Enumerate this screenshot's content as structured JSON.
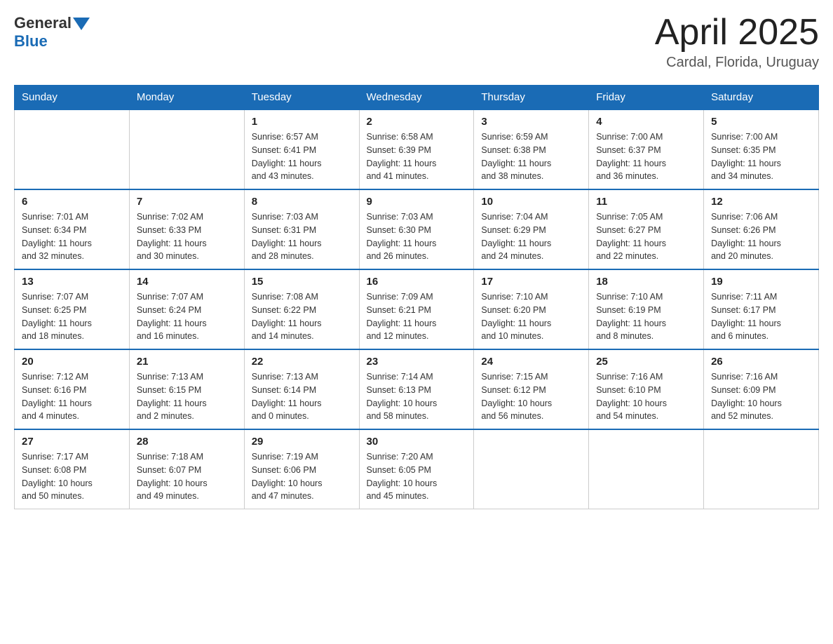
{
  "logo": {
    "text_general": "General",
    "text_blue": "Blue"
  },
  "title": "April 2025",
  "location": "Cardal, Florida, Uruguay",
  "days_of_week": [
    "Sunday",
    "Monday",
    "Tuesday",
    "Wednesday",
    "Thursday",
    "Friday",
    "Saturday"
  ],
  "weeks": [
    [
      {
        "day": "",
        "info": ""
      },
      {
        "day": "",
        "info": ""
      },
      {
        "day": "1",
        "info": "Sunrise: 6:57 AM\nSunset: 6:41 PM\nDaylight: 11 hours\nand 43 minutes."
      },
      {
        "day": "2",
        "info": "Sunrise: 6:58 AM\nSunset: 6:39 PM\nDaylight: 11 hours\nand 41 minutes."
      },
      {
        "day": "3",
        "info": "Sunrise: 6:59 AM\nSunset: 6:38 PM\nDaylight: 11 hours\nand 38 minutes."
      },
      {
        "day": "4",
        "info": "Sunrise: 7:00 AM\nSunset: 6:37 PM\nDaylight: 11 hours\nand 36 minutes."
      },
      {
        "day": "5",
        "info": "Sunrise: 7:00 AM\nSunset: 6:35 PM\nDaylight: 11 hours\nand 34 minutes."
      }
    ],
    [
      {
        "day": "6",
        "info": "Sunrise: 7:01 AM\nSunset: 6:34 PM\nDaylight: 11 hours\nand 32 minutes."
      },
      {
        "day": "7",
        "info": "Sunrise: 7:02 AM\nSunset: 6:33 PM\nDaylight: 11 hours\nand 30 minutes."
      },
      {
        "day": "8",
        "info": "Sunrise: 7:03 AM\nSunset: 6:31 PM\nDaylight: 11 hours\nand 28 minutes."
      },
      {
        "day": "9",
        "info": "Sunrise: 7:03 AM\nSunset: 6:30 PM\nDaylight: 11 hours\nand 26 minutes."
      },
      {
        "day": "10",
        "info": "Sunrise: 7:04 AM\nSunset: 6:29 PM\nDaylight: 11 hours\nand 24 minutes."
      },
      {
        "day": "11",
        "info": "Sunrise: 7:05 AM\nSunset: 6:27 PM\nDaylight: 11 hours\nand 22 minutes."
      },
      {
        "day": "12",
        "info": "Sunrise: 7:06 AM\nSunset: 6:26 PM\nDaylight: 11 hours\nand 20 minutes."
      }
    ],
    [
      {
        "day": "13",
        "info": "Sunrise: 7:07 AM\nSunset: 6:25 PM\nDaylight: 11 hours\nand 18 minutes."
      },
      {
        "day": "14",
        "info": "Sunrise: 7:07 AM\nSunset: 6:24 PM\nDaylight: 11 hours\nand 16 minutes."
      },
      {
        "day": "15",
        "info": "Sunrise: 7:08 AM\nSunset: 6:22 PM\nDaylight: 11 hours\nand 14 minutes."
      },
      {
        "day": "16",
        "info": "Sunrise: 7:09 AM\nSunset: 6:21 PM\nDaylight: 11 hours\nand 12 minutes."
      },
      {
        "day": "17",
        "info": "Sunrise: 7:10 AM\nSunset: 6:20 PM\nDaylight: 11 hours\nand 10 minutes."
      },
      {
        "day": "18",
        "info": "Sunrise: 7:10 AM\nSunset: 6:19 PM\nDaylight: 11 hours\nand 8 minutes."
      },
      {
        "day": "19",
        "info": "Sunrise: 7:11 AM\nSunset: 6:17 PM\nDaylight: 11 hours\nand 6 minutes."
      }
    ],
    [
      {
        "day": "20",
        "info": "Sunrise: 7:12 AM\nSunset: 6:16 PM\nDaylight: 11 hours\nand 4 minutes."
      },
      {
        "day": "21",
        "info": "Sunrise: 7:13 AM\nSunset: 6:15 PM\nDaylight: 11 hours\nand 2 minutes."
      },
      {
        "day": "22",
        "info": "Sunrise: 7:13 AM\nSunset: 6:14 PM\nDaylight: 11 hours\nand 0 minutes."
      },
      {
        "day": "23",
        "info": "Sunrise: 7:14 AM\nSunset: 6:13 PM\nDaylight: 10 hours\nand 58 minutes."
      },
      {
        "day": "24",
        "info": "Sunrise: 7:15 AM\nSunset: 6:12 PM\nDaylight: 10 hours\nand 56 minutes."
      },
      {
        "day": "25",
        "info": "Sunrise: 7:16 AM\nSunset: 6:10 PM\nDaylight: 10 hours\nand 54 minutes."
      },
      {
        "day": "26",
        "info": "Sunrise: 7:16 AM\nSunset: 6:09 PM\nDaylight: 10 hours\nand 52 minutes."
      }
    ],
    [
      {
        "day": "27",
        "info": "Sunrise: 7:17 AM\nSunset: 6:08 PM\nDaylight: 10 hours\nand 50 minutes."
      },
      {
        "day": "28",
        "info": "Sunrise: 7:18 AM\nSunset: 6:07 PM\nDaylight: 10 hours\nand 49 minutes."
      },
      {
        "day": "29",
        "info": "Sunrise: 7:19 AM\nSunset: 6:06 PM\nDaylight: 10 hours\nand 47 minutes."
      },
      {
        "day": "30",
        "info": "Sunrise: 7:20 AM\nSunset: 6:05 PM\nDaylight: 10 hours\nand 45 minutes."
      },
      {
        "day": "",
        "info": ""
      },
      {
        "day": "",
        "info": ""
      },
      {
        "day": "",
        "info": ""
      }
    ]
  ]
}
